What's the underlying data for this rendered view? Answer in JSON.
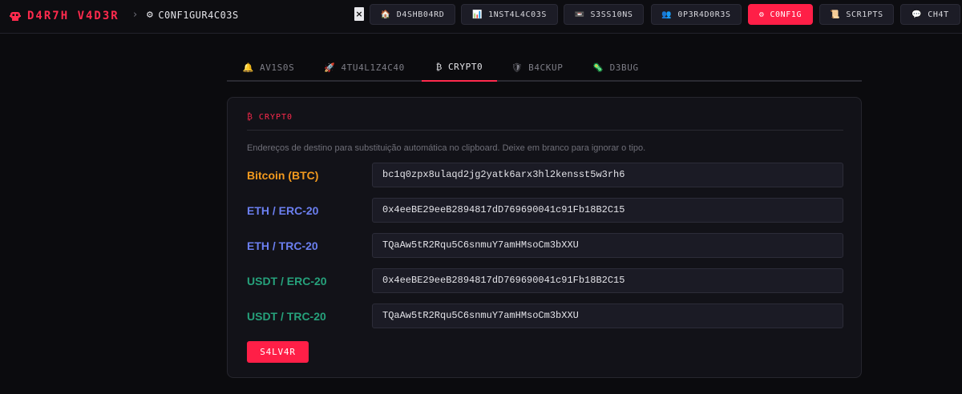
{
  "header": {
    "brand": "D4R7H V4D3R",
    "breadcrumb_sep": "›",
    "breadcrumb": "C0NF1GUR4C03S",
    "close_glyph": "×"
  },
  "nav": [
    {
      "label": "D4SHB04RD",
      "icon": "house-icon",
      "glyph": "🏠"
    },
    {
      "label": "1NST4L4C03S",
      "icon": "chart-icon",
      "glyph": "📊"
    },
    {
      "label": "S3SS10NS",
      "icon": "camera-icon",
      "glyph": "📼"
    },
    {
      "label": "0P3R4D0R3S",
      "icon": "users-icon",
      "glyph": "👥"
    },
    {
      "label": "C0NF1G",
      "icon": "gear-icon",
      "glyph": "⚙",
      "active": true
    },
    {
      "label": "SCR1PTS",
      "icon": "scroll-icon",
      "glyph": "📜"
    },
    {
      "label": "CH4T",
      "icon": "speech-bubble-icon",
      "glyph": "💬"
    }
  ],
  "tabs": [
    {
      "label": "AV1S0S",
      "icon": "bell-icon",
      "glyph": "🔔"
    },
    {
      "label": "4TU4L1Z4C40",
      "icon": "rocket-icon",
      "glyph": "🚀"
    },
    {
      "label": "CRYPT0",
      "icon": "bitcoin-icon",
      "glyph": "₿",
      "active": true
    },
    {
      "label": "B4CKUP",
      "icon": "shield-icon",
      "glyph": "🛡"
    },
    {
      "label": "D3BUG",
      "icon": "bug-icon",
      "glyph": "🦠"
    }
  ],
  "card": {
    "title_glyph": "₿",
    "title": "CRYPT0",
    "description": "Endereços de destino para substituição automática no clipboard. Deixe em branco para ignorar o tipo."
  },
  "wallets": [
    {
      "label": "Bitcoin (BTC)",
      "value": "bc1q0zpx8ulaqd2jg2yatk6arx3hl2kensst5w3rh6",
      "color": "#f39a1e"
    },
    {
      "label": "ETH / ERC-20",
      "value": "0x4eeBE29eeB2894817dD769690041c91Fb18B2C15",
      "color": "#6b7ff0"
    },
    {
      "label": "ETH / TRC-20",
      "value": "TQaAw5tR2Rqu5C6snmuY7amHMsoCm3bXXU",
      "color": "#6b7ff0"
    },
    {
      "label": "USDT / ERC-20",
      "value": "0x4eeBE29eeB2894817dD769690041c91Fb18B2C15",
      "color": "#26a17b"
    },
    {
      "label": "USDT / TRC-20",
      "value": "TQaAw5tR2Rqu5C6snmuY7amHMsoCm3bXXU",
      "color": "#26a17b"
    }
  ],
  "save_label": "S4LV4R",
  "colors": {
    "accent": "#ff1f47",
    "background": "#0b0b0e",
    "card": "#121218"
  }
}
